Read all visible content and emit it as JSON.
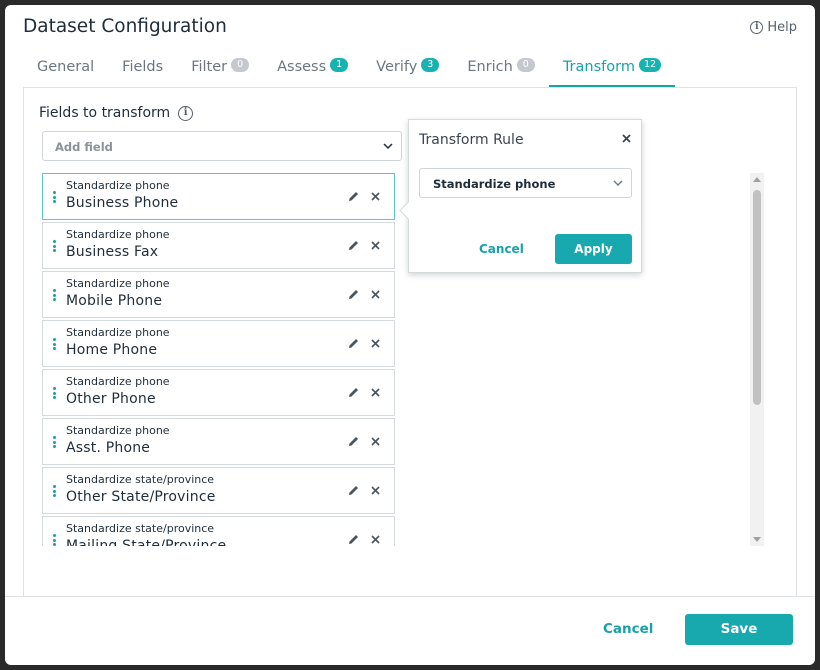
{
  "dialog": {
    "title": "Dataset Configuration",
    "help_label": "Help"
  },
  "tabs": [
    {
      "label": "General",
      "badge": ""
    },
    {
      "label": "Fields",
      "badge": ""
    },
    {
      "label": "Filter",
      "badge": "0"
    },
    {
      "label": "Assess",
      "badge": "1"
    },
    {
      "label": "Verify",
      "badge": "3"
    },
    {
      "label": "Enrich",
      "badge": "0"
    },
    {
      "label": "Transform",
      "badge": "12"
    }
  ],
  "active_tab": "Transform",
  "transform": {
    "section_title": "Fields to transform",
    "add_field_placeholder": "Add field",
    "items": [
      {
        "rule": "Standardize phone",
        "name": "Business Phone"
      },
      {
        "rule": "Standardize phone",
        "name": "Business Fax"
      },
      {
        "rule": "Standardize phone",
        "name": "Mobile Phone"
      },
      {
        "rule": "Standardize phone",
        "name": "Home Phone"
      },
      {
        "rule": "Standardize phone",
        "name": "Other Phone"
      },
      {
        "rule": "Standardize phone",
        "name": "Asst. Phone"
      },
      {
        "rule": "Standardize state/province",
        "name": "Other State/Province"
      },
      {
        "rule": "Standardize state/province",
        "name": "Mailing State/Province"
      }
    ]
  },
  "popover": {
    "title": "Transform Rule",
    "selected_rule": "Standardize phone",
    "cancel_label": "Cancel",
    "apply_label": "Apply"
  },
  "footer": {
    "cancel_label": "Cancel",
    "save_label": "Save"
  },
  "colors": {
    "accent": "#17a9ad",
    "badge_active": "#17b3b3",
    "badge_zero": "#c5c9cd",
    "text": "#1f2d3a"
  }
}
